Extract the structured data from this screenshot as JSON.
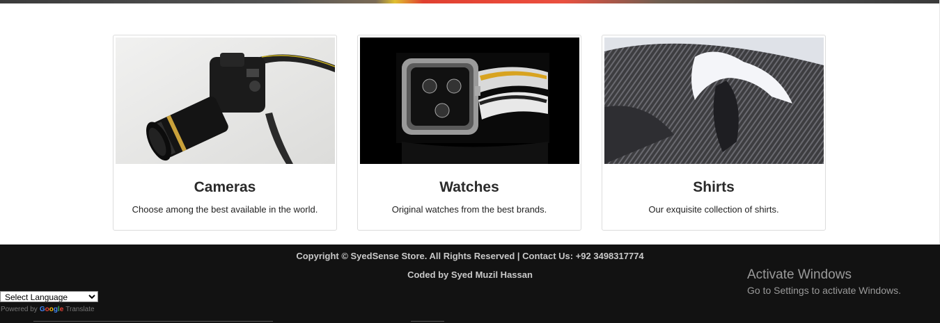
{
  "cards": [
    {
      "title": "Cameras",
      "desc": "Choose among the best available in the world.",
      "image_icon": "camera-image"
    },
    {
      "title": "Watches",
      "desc": "Original watches from the best brands.",
      "image_icon": "watch-image"
    },
    {
      "title": "Shirts",
      "desc": "Our exquisite collection of shirts.",
      "image_icon": "shirt-image"
    }
  ],
  "footer": {
    "copyright": "Copyright © SyedSense Store. All Rights Reserved | Contact Us: +92 3498317774",
    "coded_by": "Coded by Syed Muzil Hassan"
  },
  "translate": {
    "select_label": "Select Language",
    "powered_by": "Powered by",
    "google": "Google",
    "translate": "Translate"
  },
  "activation": {
    "title": "Activate Windows",
    "subtitle": "Go to Settings to activate Windows."
  },
  "colors": {
    "footer_bg": "#121212",
    "google_blue": "#4285f4",
    "google_red": "#ea4335",
    "google_yellow": "#fbbc05",
    "google_green": "#34a853"
  }
}
